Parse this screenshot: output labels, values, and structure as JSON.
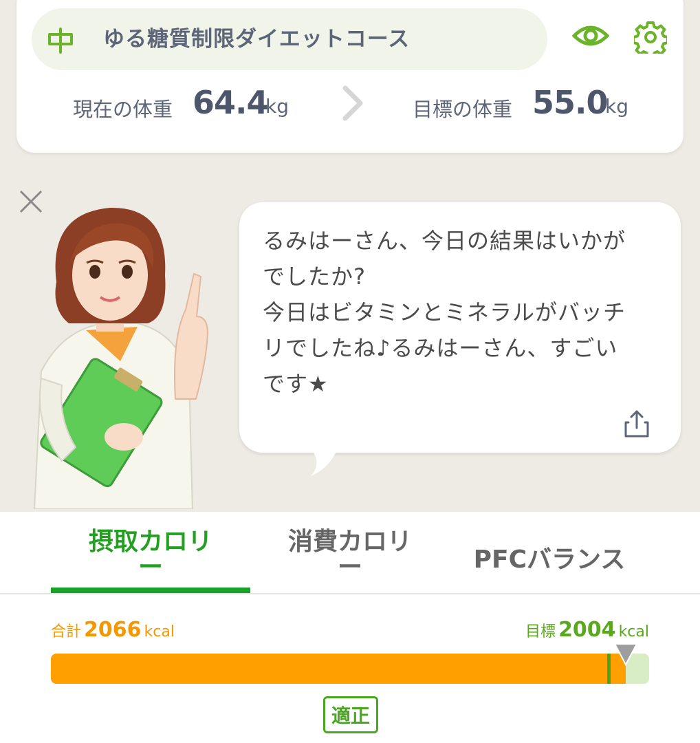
{
  "course": {
    "name": "ゆる糖質制限ダイエットコース",
    "icon": "signpost-icon",
    "actions": [
      "eye-icon",
      "gear-icon"
    ]
  },
  "weight": {
    "current_label": "現在の体重",
    "current_value": "64.4",
    "current_unit": "kg",
    "target_label": "目標の体重",
    "target_value": "55.0",
    "target_unit": "kg"
  },
  "advice": {
    "message": "るみはーさん、今日の結果はいかが\nでしたか?\n今日はビタミンとミネラルがバッチ\nリでしたね♪るみはーさん、すごい\nです★"
  },
  "tabs": [
    {
      "label": "摂取カロリ",
      "sub": "ー",
      "active": true
    },
    {
      "label": "消費カロリ",
      "sub": "ー",
      "active": false
    },
    {
      "label": "PFCバランス",
      "sub": "",
      "active": false
    }
  ],
  "calories": {
    "total_label": "合計",
    "total_value": "2066",
    "total_unit": "kcal",
    "target_label": "目標",
    "target_value": "2004",
    "target_unit": "kcal",
    "bar_max": 2150,
    "status": "適正"
  },
  "colors": {
    "accent_green": "#23a021",
    "intake_orange": "#ff9f00",
    "text_slate": "#4d566b"
  }
}
